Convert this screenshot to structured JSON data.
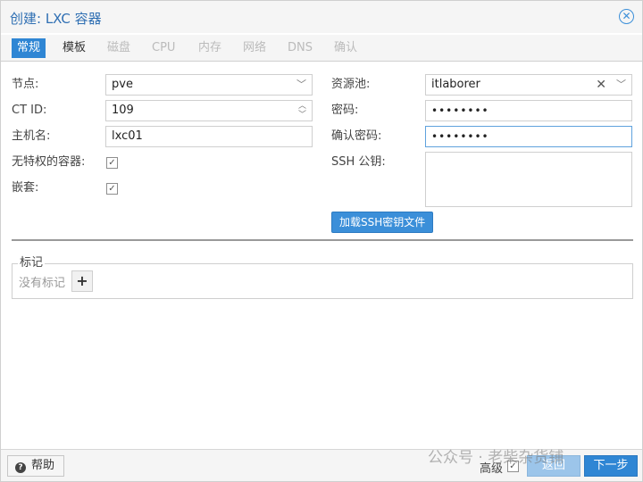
{
  "window": {
    "title": "创建: LXC 容器",
    "close_icon": "close-icon"
  },
  "tabs": [
    {
      "label": "常规",
      "state": "active"
    },
    {
      "label": "模板",
      "state": "enabled"
    },
    {
      "label": "磁盘",
      "state": "disabled"
    },
    {
      "label": "CPU",
      "state": "disabled"
    },
    {
      "label": "内存",
      "state": "disabled"
    },
    {
      "label": "网络",
      "state": "disabled"
    },
    {
      "label": "DNS",
      "state": "disabled"
    },
    {
      "label": "确认",
      "state": "disabled"
    }
  ],
  "form": {
    "node": {
      "label": "节点:",
      "value": "pve"
    },
    "ctid": {
      "label": "CT ID:",
      "value": "109"
    },
    "hostname": {
      "label": "主机名:",
      "value": "lxc01"
    },
    "unprivileged": {
      "label": "无特权的容器:",
      "checked": true
    },
    "nesting": {
      "label": "嵌套:",
      "checked": true
    },
    "pool": {
      "label": "资源池:",
      "value": "itlaborer"
    },
    "password": {
      "label": "密码:",
      "value": "••••••••"
    },
    "confirm_password": {
      "label": "确认密码:",
      "value": "••••••••"
    },
    "ssh_key": {
      "label": "SSH 公钥:",
      "value": ""
    },
    "load_ssh_button": "加载SSH密钥文件"
  },
  "tags": {
    "legend": "标记",
    "empty_text": "没有标记",
    "add_symbol": "+"
  },
  "footer": {
    "help_label": "帮助",
    "advanced_label": "高级",
    "advanced_checked": true,
    "back_label": "返回",
    "next_label": "下一步"
  },
  "watermark": "公众号 · 老柴杂货铺",
  "colors": {
    "accent": "#2f86d4",
    "title": "#2f6fb3",
    "disabled_tab": "#bbbbbb"
  }
}
